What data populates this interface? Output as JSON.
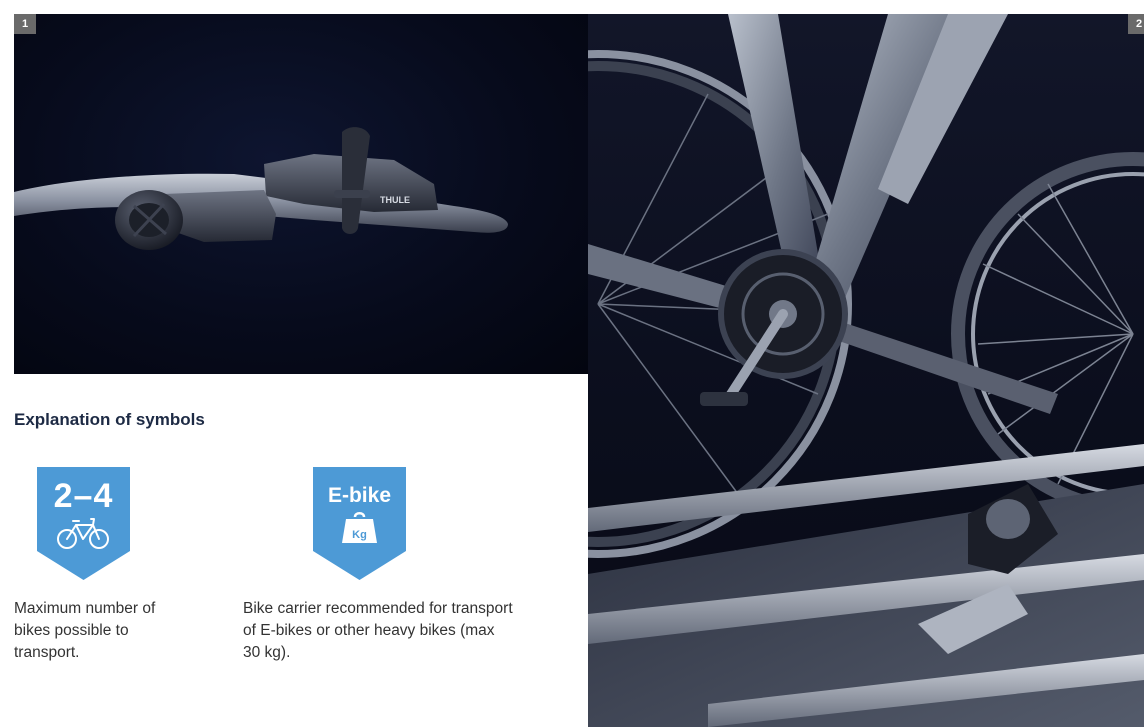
{
  "pages": {
    "left_number": "1",
    "right_number": "2"
  },
  "section": {
    "heading": "Explanation of symbols"
  },
  "symbols": [
    {
      "icon": "bike-count-badge",
      "badge_text": "2–4",
      "color": "#4d9ad6",
      "description": "Maximum number of bikes possible to transport."
    },
    {
      "icon": "ebike-weight-badge",
      "badge_text": "E-bike",
      "weight_label": "Kg",
      "color": "#4d9ad6",
      "description": "Bike carrier recommended for transport of E-bikes or other heavy bikes (max 30 kg)."
    }
  ],
  "photos": {
    "left_brand_mark": "THULE"
  }
}
